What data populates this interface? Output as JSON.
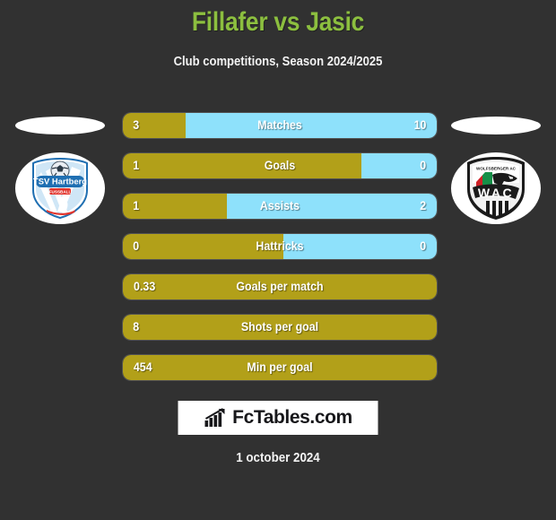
{
  "header": {
    "title": "Fillafer vs Jasic",
    "subtitle": "Club competitions, Season 2024/2025",
    "title_color": "#8CBF3F"
  },
  "teams": {
    "home": {
      "logo_name": "tsv-hartberg-crest",
      "logo_line1": "TSV Hartberg",
      "logo_line2": "FUSSBALL"
    },
    "away": {
      "logo_name": "wac-wolfsberger-crest",
      "logo_text": "WAC"
    }
  },
  "colors": {
    "background": "#313131",
    "home_bar": "#B2A019",
    "away_bar": "#8EE1FB",
    "text": "#ffffff"
  },
  "chart_data": {
    "type": "bar",
    "title": "Fillafer vs Jasic",
    "subtitle": "Club competitions, Season 2024/2025",
    "orientation": "horizontal-diverging",
    "series": [
      {
        "name": "Fillafer",
        "color": "#B2A019"
      },
      {
        "name": "Jasic",
        "color": "#8EE1FB"
      }
    ],
    "rows": [
      {
        "label": "Matches",
        "home": "3",
        "away": "10",
        "home_pct": 20,
        "two_sided": true
      },
      {
        "label": "Goals",
        "home": "1",
        "away": "0",
        "home_pct": 76,
        "two_sided": true
      },
      {
        "label": "Assists",
        "home": "1",
        "away": "2",
        "home_pct": 33,
        "two_sided": true
      },
      {
        "label": "Hattricks",
        "home": "0",
        "away": "0",
        "home_pct": 51,
        "two_sided": true
      },
      {
        "label": "Goals per match",
        "home": "0.33",
        "away": "",
        "home_pct": 100,
        "two_sided": false
      },
      {
        "label": "Shots per goal",
        "home": "8",
        "away": "",
        "home_pct": 100,
        "two_sided": false
      },
      {
        "label": "Min per goal",
        "home": "454",
        "away": "",
        "home_pct": 100,
        "two_sided": false
      }
    ]
  },
  "footer": {
    "brand": "FcTables.com",
    "brand_icon": "bar-chart-icon",
    "date": "1 october 2024"
  }
}
